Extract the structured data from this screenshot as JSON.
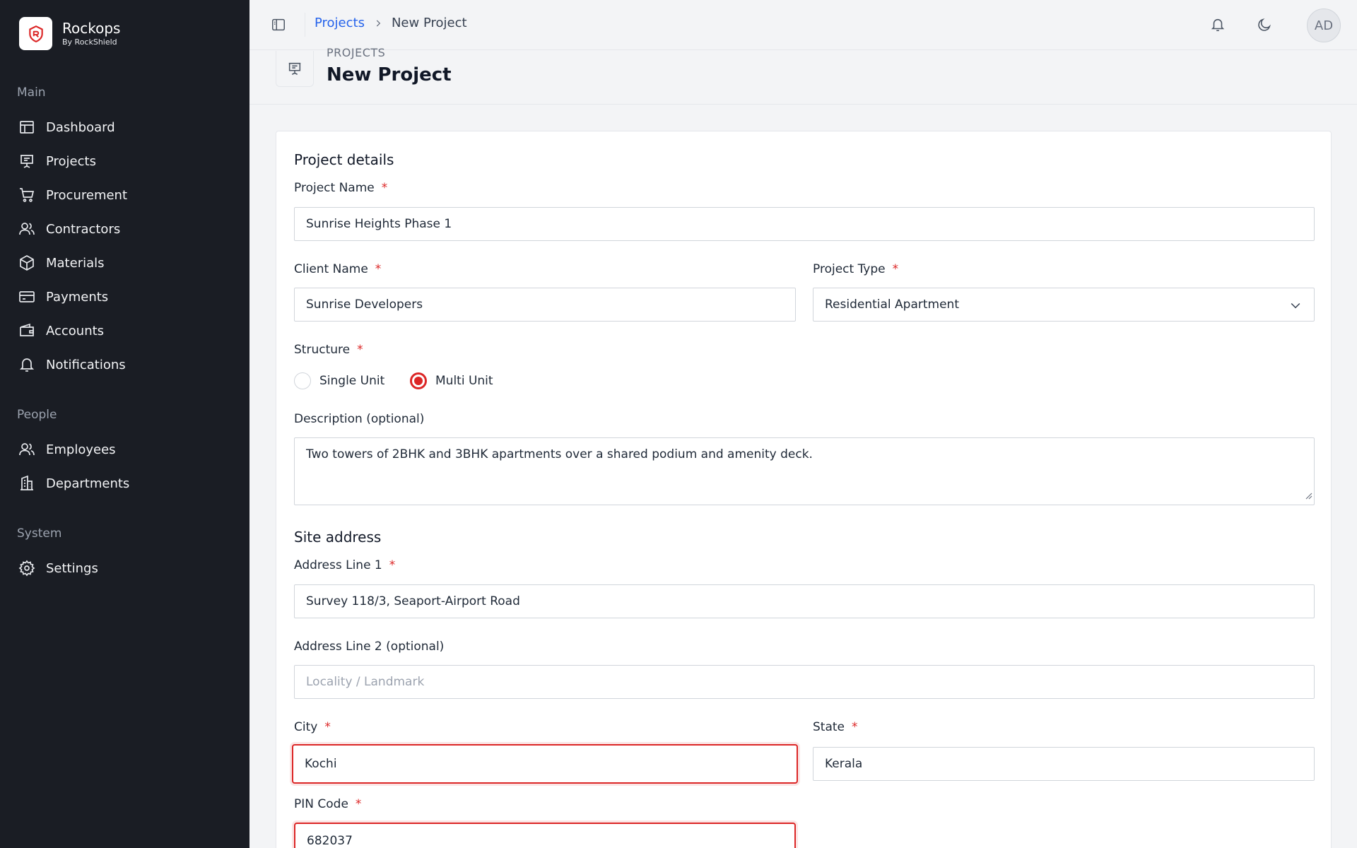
{
  "brand": {
    "name": "Rockops",
    "subtitle": "By RockShield"
  },
  "sidebar": {
    "sections": [
      {
        "label": "Main"
      },
      {
        "label": "People"
      },
      {
        "label": "System"
      }
    ],
    "items": [
      {
        "label": "Dashboard",
        "icon": "dashboard-icon"
      },
      {
        "label": "Projects",
        "icon": "projects-icon"
      },
      {
        "label": "Procurement",
        "icon": "cart-icon"
      },
      {
        "label": "Contractors",
        "icon": "users-icon"
      },
      {
        "label": "Materials",
        "icon": "box-icon"
      },
      {
        "label": "Payments",
        "icon": "credit-card-icon"
      },
      {
        "label": "Accounts",
        "icon": "wallet-icon"
      },
      {
        "label": "Notifications",
        "icon": "bell-icon"
      },
      {
        "label": "Employees",
        "icon": "users-icon"
      },
      {
        "label": "Departments",
        "icon": "building-icon"
      },
      {
        "label": "Settings",
        "icon": "gear-icon"
      }
    ]
  },
  "topbar": {
    "breadcrumb": {
      "parent": "Projects",
      "current": "New Project"
    },
    "avatar_initials": "AD",
    "icons": [
      "sidebar-toggle-icon",
      "bell-icon",
      "moon-icon"
    ]
  },
  "page": {
    "eyebrow": "PROJECTS",
    "title": "New Project"
  },
  "form": {
    "project_details_title": "Project details",
    "project_name": {
      "label": "Project Name",
      "value": "Sunrise Heights Phase 1"
    },
    "client_name": {
      "label": "Client Name",
      "value": "Sunrise Developers"
    },
    "project_type": {
      "label": "Project Type",
      "value": "Residential Apartment"
    },
    "structure": {
      "label": "Structure",
      "options": [
        "Single Unit",
        "Multi Unit"
      ],
      "selected": "Multi Unit"
    },
    "description": {
      "label": "Description (optional)",
      "value": "Two towers of 2BHK and 3BHK apartments over a shared podium and amenity deck."
    },
    "site_address_title": "Site address",
    "address_line1": {
      "label": "Address Line 1",
      "value": "Survey 118/3, Seaport-Airport Road"
    },
    "address_line2": {
      "label": "Address Line 2 (optional)",
      "placeholder": "Locality / Landmark"
    },
    "city": {
      "label": "City",
      "value": "Kochi"
    },
    "state": {
      "label": "State",
      "value": "Kerala"
    },
    "pin_code": {
      "label": "PIN Code",
      "value": "682037"
    },
    "required_mark": "*"
  },
  "colors": {
    "sidebar_bg": "#1a1d24",
    "accent": "#dc2626",
    "link": "#2563eb"
  }
}
